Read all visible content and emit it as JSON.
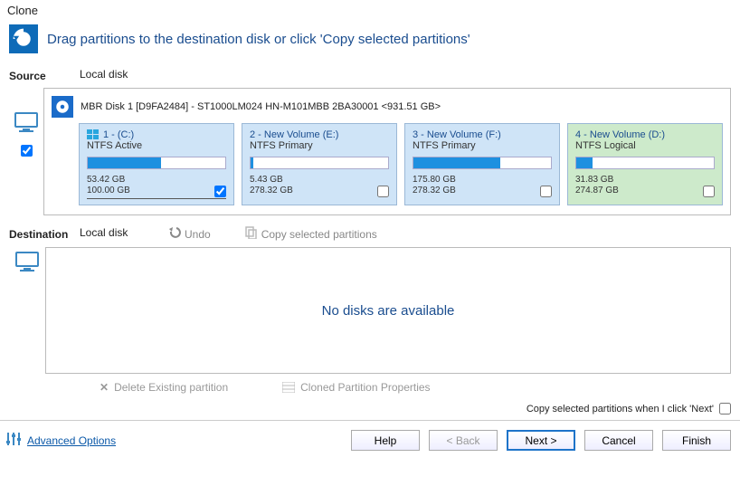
{
  "title": "Clone",
  "header": {
    "text": "Drag partitions to the destination disk or click 'Copy selected partitions'"
  },
  "source": {
    "label": "Source",
    "sub": "Local disk",
    "checked": true,
    "disk_title": "MBR Disk 1 [D9FA2484] - ST1000LM024 HN-M101MBB 2BA30001  <931.51 GB>",
    "partitions": [
      {
        "title": "1 -  (C:)",
        "fs": "NTFS Active",
        "used": "53.42 GB",
        "total": "100.00 GB",
        "fill_pct": 53,
        "checked": true,
        "win": true,
        "color": "blue",
        "underline": true
      },
      {
        "title": "2 - New Volume (E:)",
        "fs": "NTFS Primary",
        "used": "5.43 GB",
        "total": "278.32 GB",
        "fill_pct": 2,
        "checked": false,
        "win": false,
        "color": "blue",
        "underline": false
      },
      {
        "title": "3 - New Volume (F:)",
        "fs": "NTFS Primary",
        "used": "175.80 GB",
        "total": "278.32 GB",
        "fill_pct": 63,
        "checked": false,
        "win": false,
        "color": "blue",
        "underline": false
      },
      {
        "title": "4 - New Volume (D:)",
        "fs": "NTFS Logical",
        "used": "31.83 GB",
        "total": "274.87 GB",
        "fill_pct": 12,
        "checked": false,
        "win": false,
        "color": "green",
        "underline": false
      }
    ]
  },
  "destination": {
    "label": "Destination",
    "sub": "Local disk",
    "undo": "Undo",
    "copy": "Copy selected partitions",
    "no_disks": "No disks are available",
    "delete_existing": "Delete Existing partition",
    "cloned_props": "Cloned Partition Properties"
  },
  "copy_next": "Copy selected partitions when I click 'Next'",
  "advanced": "Advanced Options",
  "buttons": {
    "help": "Help",
    "back": "< Back",
    "next": "Next >",
    "cancel": "Cancel",
    "finish": "Finish"
  }
}
